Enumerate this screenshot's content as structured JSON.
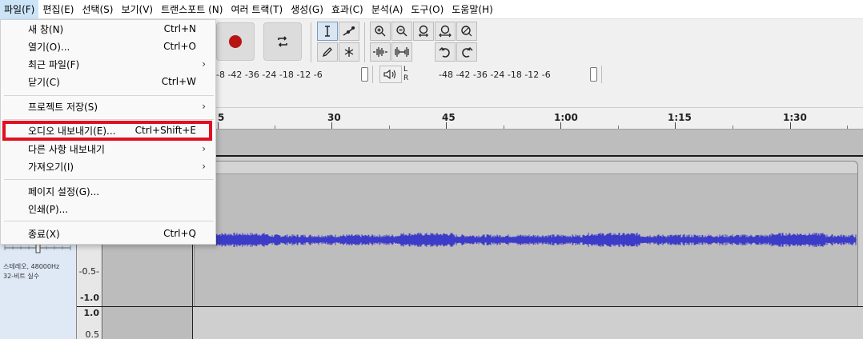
{
  "menubar": {
    "items": [
      "파일(F)",
      "편집(E)",
      "선택(S)",
      "보기(V)",
      "트랜스포트 (N)",
      "여러 트랙(T)",
      "생성(G)",
      "효과(C)",
      "분석(A)",
      "도구(O)",
      "도움말(H)"
    ]
  },
  "file_menu": {
    "items": [
      {
        "label": "새 창(N)",
        "shortcut": "Ctrl+N"
      },
      {
        "label": "열기(O)...",
        "shortcut": "Ctrl+O"
      },
      {
        "label": "최근 파일(F)",
        "arrow": "›"
      },
      {
        "label": "닫기(C)",
        "shortcut": "Ctrl+W"
      },
      {
        "label": "프로젝트 저장(S)",
        "arrow": "›"
      },
      {
        "label": "오디오 내보내기(E)...",
        "shortcut": "Ctrl+Shift+E"
      },
      {
        "label": "다른 사항 내보내기",
        "arrow": "›"
      },
      {
        "label": "가져오기(I)",
        "arrow": "›"
      },
      {
        "label": "페이지 설정(G)...",
        "shortcut": ""
      },
      {
        "label": "인쇄(P)...",
        "shortcut": ""
      },
      {
        "label": "종료(X)",
        "shortcut": "Ctrl+Q"
      }
    ],
    "highlighted_item": "오디오 내보내기(E)...",
    "highlight_color": "#e01020"
  },
  "meters": {
    "record_scale": "-8 -42 -36    -24 -18 -12  -6",
    "play_scale": "-48 -42 -36    -24 -18 -12  -6",
    "left_channel": "L",
    "right_channel": "R"
  },
  "timeline": {
    "labels": [
      "5",
      "30",
      "45",
      "1:00",
      "1:15",
      "1:30"
    ]
  },
  "track": {
    "format": "스테레오, 48000Hz",
    "bit_depth": "32-비트 실수",
    "scale_labels": [
      "-0.5-",
      "-1.0",
      "1.0",
      "0.5"
    ],
    "waveform_color": "#3c3cc8"
  },
  "icons": {
    "record": "record-icon",
    "loop": "loop-icon",
    "select_tool": "i-beam-icon",
    "envelope_tool": "envelope-icon",
    "draw_tool": "pencil-icon",
    "multi_tool": "asterisk-icon",
    "zoom_in": "zoom-in-icon",
    "zoom_out": "zoom-out-icon",
    "fit_selection": "zoom-sel-icon",
    "fit_project": "zoom-fit-icon",
    "zoom_toggle": "zoom-toggle-icon",
    "trim": "trim-icon",
    "silence": "silence-icon",
    "undo": "undo-icon",
    "redo": "redo-icon",
    "speaker": "speaker-icon"
  }
}
